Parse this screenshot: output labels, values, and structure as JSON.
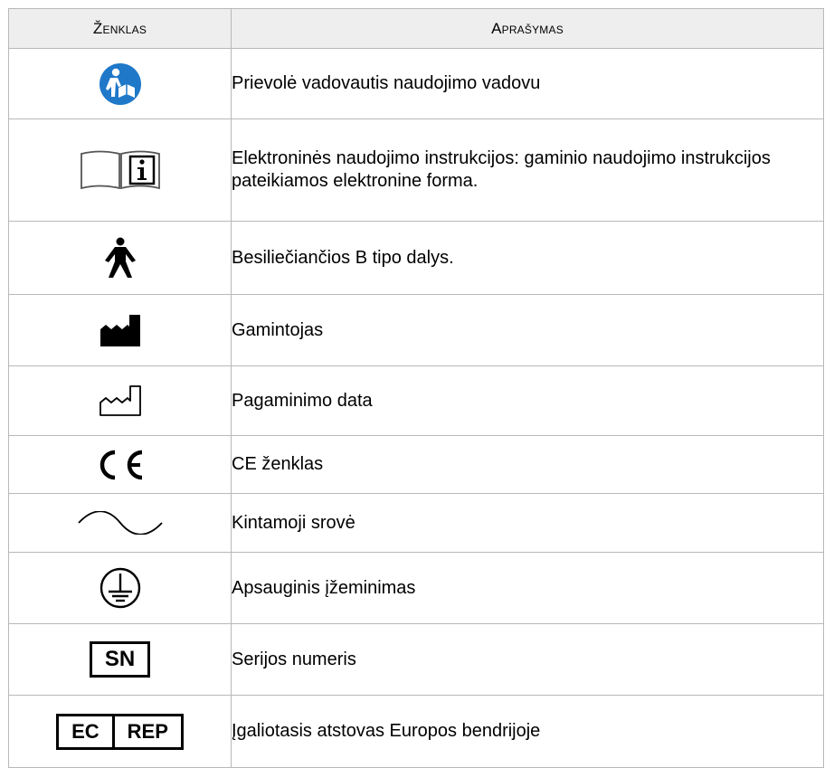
{
  "table": {
    "header": {
      "symbol": "Ženklas",
      "description": "Aprašymas"
    },
    "rows": [
      {
        "icon": "read-manual-icon",
        "description": "Prievolė vadovautis naudojimo vadovu"
      },
      {
        "icon": "electronic-ifu-icon",
        "description": "Elektroninės naudojimo instrukcijos: gaminio naudojimo instrukcijos pateikiamos elektronine forma."
      },
      {
        "icon": "type-b-applied-part-icon",
        "description": "Besiliečiančios B tipo dalys."
      },
      {
        "icon": "manufacturer-icon",
        "description": "Gamintojas"
      },
      {
        "icon": "date-of-manufacture-icon",
        "description": "Pagaminimo data"
      },
      {
        "icon": "ce-mark-icon",
        "symbol_text": "CE",
        "description": "CE ženklas"
      },
      {
        "icon": "alternating-current-icon",
        "description": "Kintamoji srovė"
      },
      {
        "icon": "protective-earth-icon",
        "description": "Apsauginis įžeminimas"
      },
      {
        "icon": "serial-number-icon",
        "symbol_text": "SN",
        "description": "Serijos numeris"
      },
      {
        "icon": "ec-rep-icon",
        "symbol_text_left": "EC",
        "symbol_text_right": "REP",
        "description": "Įgaliotasis atstovas Europos bendrijoje"
      }
    ]
  },
  "colors": {
    "header_bg": "#eeeeee",
    "border": "#b8b8b8",
    "mandatory_blue": "#1f78c8"
  }
}
